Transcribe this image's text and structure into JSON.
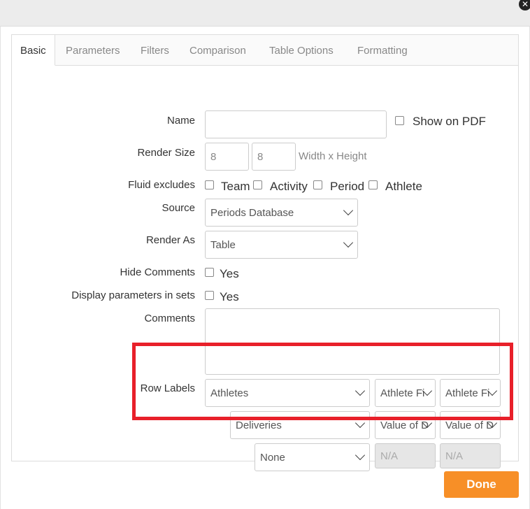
{
  "tabs": [
    "Basic",
    "Parameters",
    "Filters",
    "Comparison",
    "Table Options",
    "Formatting"
  ],
  "form": {
    "name_label": "Name",
    "name_value": "",
    "show_on_pdf": "Show on PDF",
    "render_size_label": "Render Size",
    "width_value": "8",
    "height_value": "8",
    "size_hint": "Width x Height",
    "fluid_label": "Fluid excludes",
    "fluid_options": [
      "Team",
      "Activity",
      "Period",
      "Athlete"
    ],
    "source_label": "Source",
    "source_value": "Periods Database",
    "render_as_label": "Render As",
    "render_as_value": "Table",
    "hide_comments_label": "Hide Comments",
    "hide_comments_opt": "Yes",
    "display_params_label": "Display parameters in sets",
    "display_params_opt": "Yes",
    "comments_label": "Comments",
    "row_labels_label": "Row Labels",
    "row1": {
      "main": "Athletes",
      "opt1": "Athlete Fi",
      "opt2": "Athlete Fi"
    },
    "row2": {
      "main": "Deliveries",
      "opt1": "Value of D",
      "opt2": "Value of D"
    },
    "row3": {
      "main": "None",
      "opt1": "N/A",
      "opt2": "N/A"
    }
  },
  "done_label": "Done"
}
